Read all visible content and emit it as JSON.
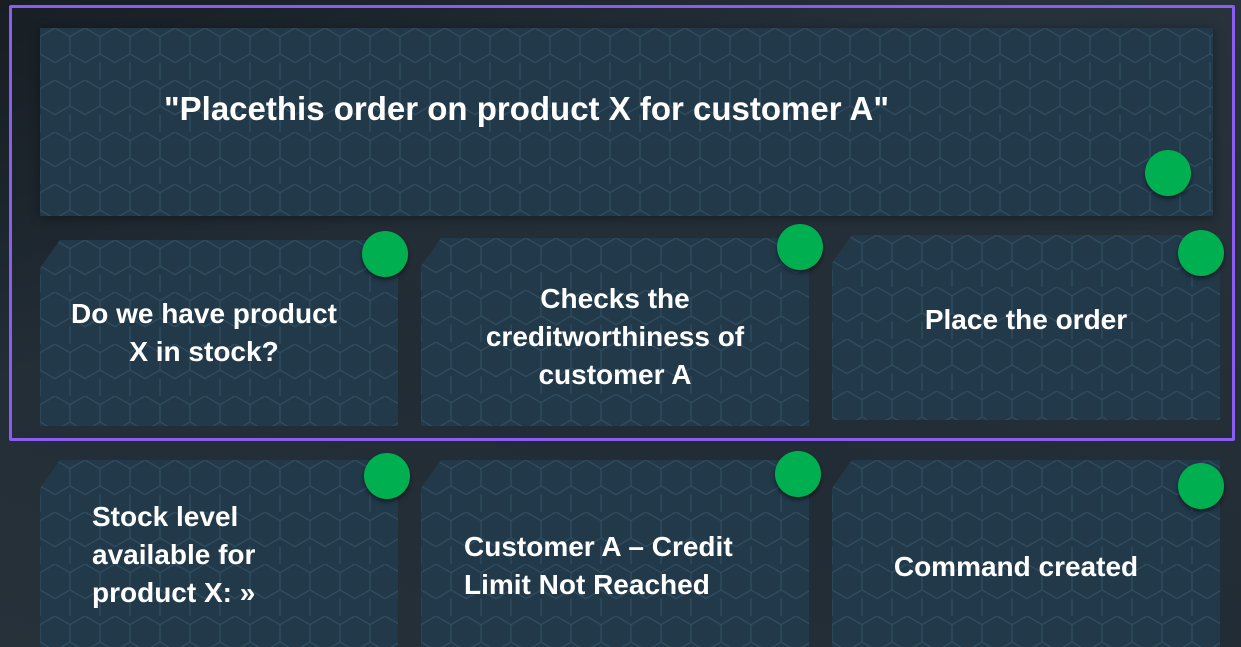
{
  "main_statement": "\"Placethis order on product X for customer A\"",
  "row1": {
    "stock_question": "Do we have product X in stock?",
    "credit_check": "Checks the creditworthiness of customer A",
    "place_order": "Place the order"
  },
  "row2": {
    "stock_level": "Stock level available for product X: »",
    "credit_status": "Customer A – Credit Limit Not Reached",
    "command_created": "Command created"
  },
  "colors": {
    "frame": "#8a5cf0",
    "status_dot": "#00b050",
    "card": "#22394a",
    "background": "#1f2a33"
  }
}
